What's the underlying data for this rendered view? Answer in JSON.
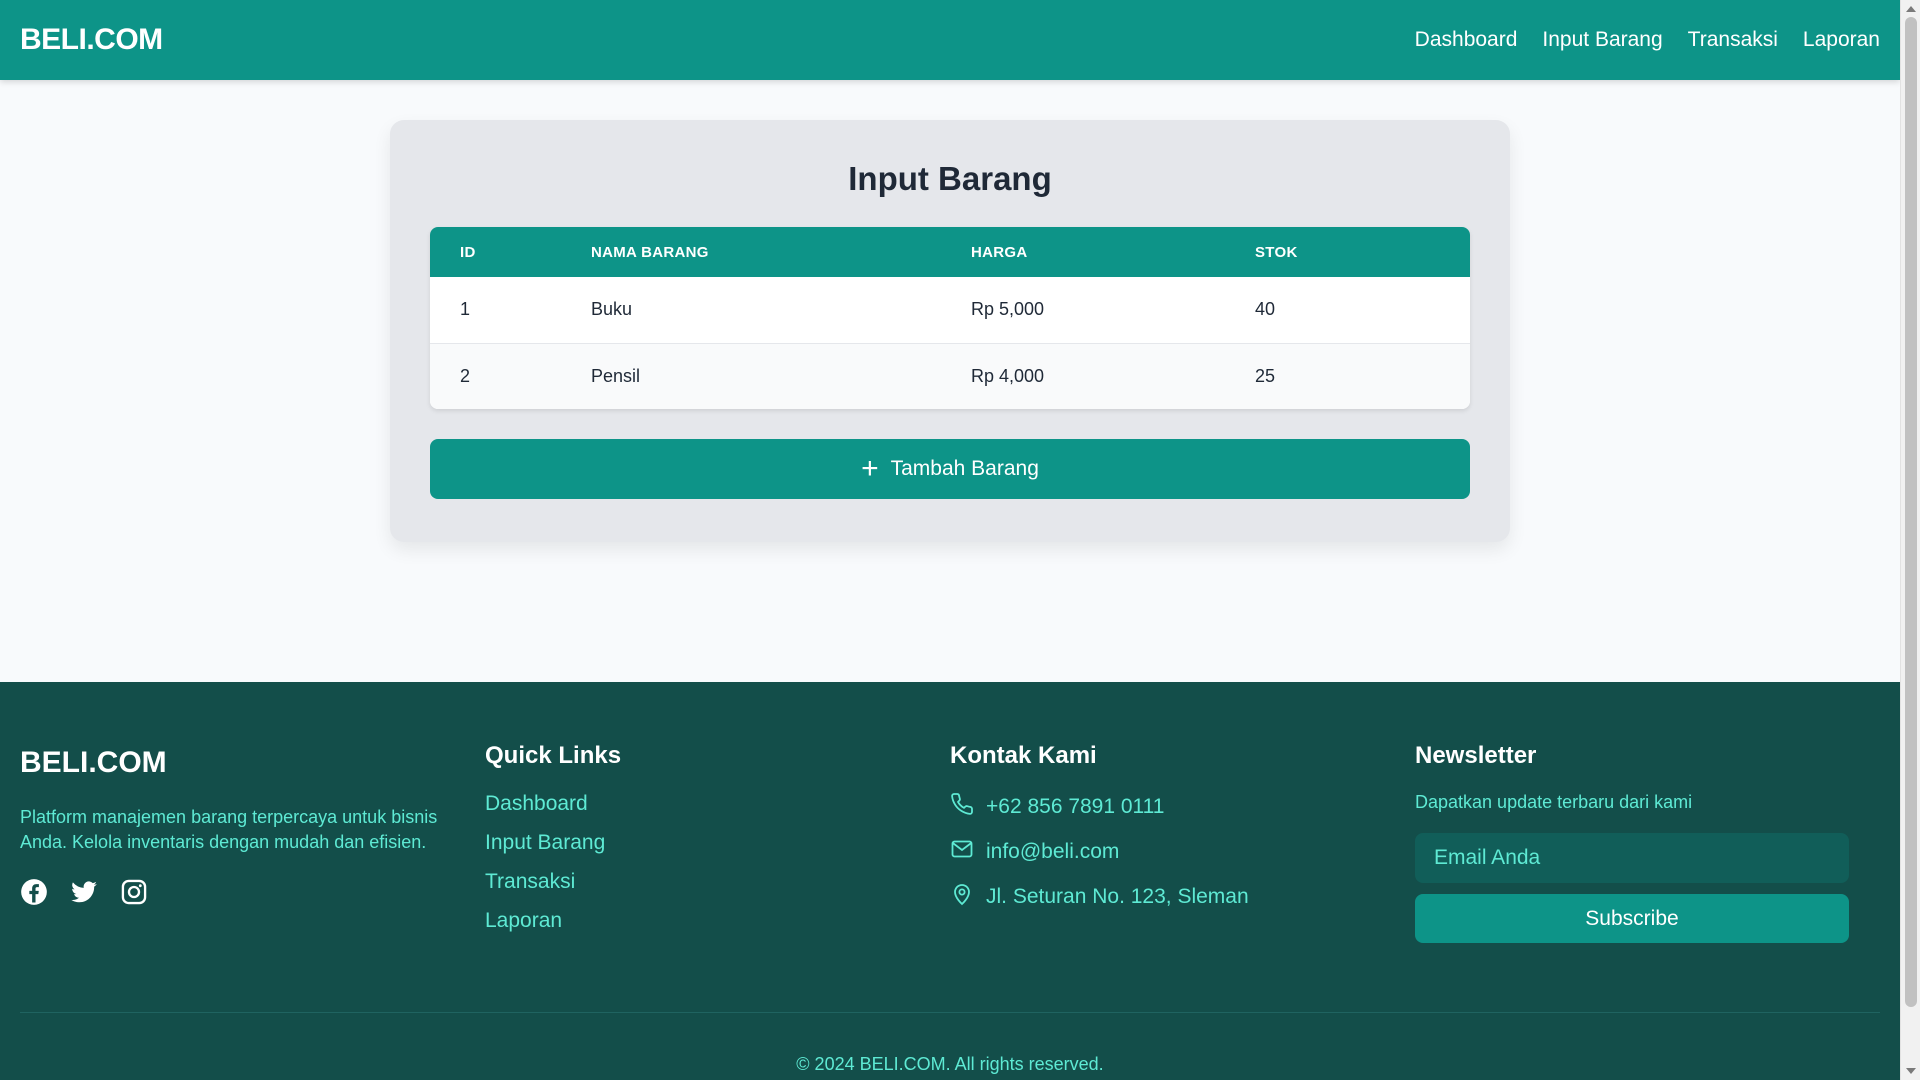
{
  "navbar": {
    "brand": "BELI.COM",
    "links": [
      "Dashboard",
      "Input Barang",
      "Transaksi",
      "Laporan"
    ]
  },
  "card": {
    "title": "Input Barang",
    "table": {
      "headers": [
        "ID",
        "NAMA BARANG",
        "HARGA",
        "STOK"
      ],
      "rows": [
        [
          "1",
          "Buku",
          "Rp 5,000",
          "40"
        ],
        [
          "2",
          "Pensil",
          "Rp 4,000",
          "25"
        ]
      ]
    },
    "add_button": "Tambah Barang",
    "add_icon": "plus-icon"
  },
  "footer": {
    "brand": "BELI.COM",
    "description": "Platform manajemen barang terpercaya untuk bisnis Anda. Kelola inventaris dengan mudah dan efisien.",
    "socials": [
      "facebook-icon",
      "twitter-icon",
      "instagram-icon"
    ],
    "quick_links": {
      "title": "Quick Links",
      "items": [
        "Dashboard",
        "Input Barang",
        "Transaksi",
        "Laporan"
      ]
    },
    "contact": {
      "title": "Kontak Kami",
      "phone": "+62 856 7891 0111",
      "email": "info@beli.com",
      "address": "Jl. Seturan No. 123, Sleman"
    },
    "newsletter": {
      "title": "Newsletter",
      "text": "Dapatkan update terbaru dari kami",
      "placeholder": "Email Anda",
      "button": "Subscribe"
    },
    "copyright": "© 2024 BELI.COM. All rights reserved."
  },
  "colors": {
    "primary": "#0d9488",
    "footer_bg": "#134e4a",
    "footer_text": "#5eead4"
  }
}
